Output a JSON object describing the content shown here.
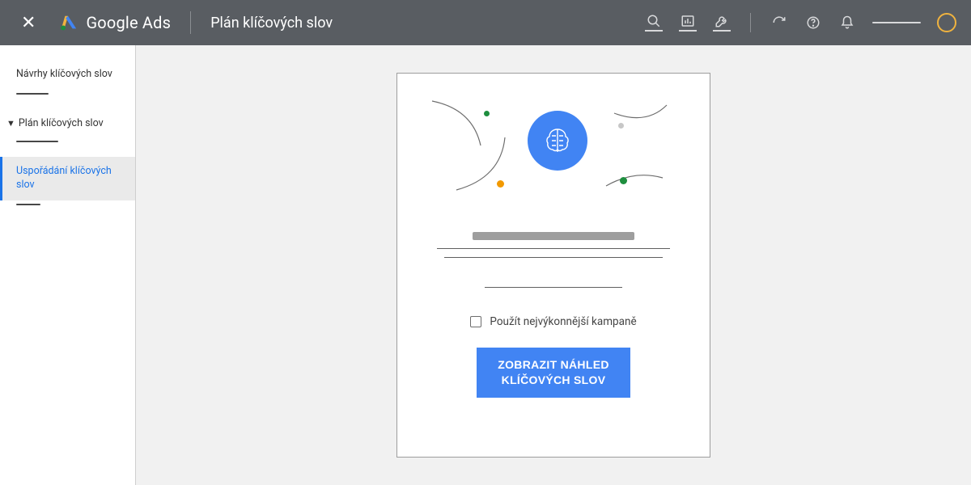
{
  "header": {
    "brand": "Google Ads",
    "page_title": "Plán klíčových slov"
  },
  "sidebar": {
    "items": [
      {
        "label": "Návrhy klíčových slov",
        "active": false
      },
      {
        "label": "Plán klíčových slov",
        "active": false,
        "expanded": true
      },
      {
        "label": "Uspořádání klíčových slov",
        "active": true
      }
    ]
  },
  "card": {
    "checkbox_label": "Použít nejvýkonnější kampaně",
    "cta_label": "ZOBRAZIT NÁHLED KLÍČOVÝCH SLOV"
  },
  "colors": {
    "brand_blue": "#4184f3",
    "brand_yellow": "#f0b33f",
    "green": "#1e8e3e",
    "orange": "#f29900"
  }
}
